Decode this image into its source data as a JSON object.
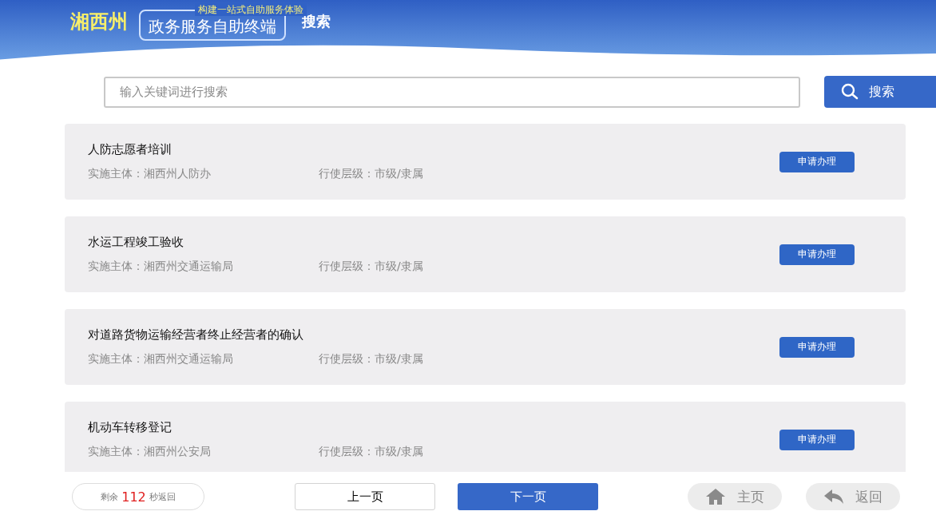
{
  "header": {
    "region": "湘西州",
    "subtitle": "构建一站式自助服务体验",
    "title": "政务服务自助终端",
    "page": "搜索"
  },
  "search": {
    "placeholder": "输入关键词进行搜索",
    "button": "搜索"
  },
  "items": [
    {
      "name": "人防志愿者培训",
      "body_label": "实施主体：",
      "body": "湘西州人防办",
      "level_label": "行使层级：",
      "level_text": "市级/隶属",
      "action": "申请办理"
    },
    {
      "name": "水运工程竣工验收",
      "body_label": "实施主体：",
      "body": "湘西州交通运输局",
      "level_label": "行使层级：",
      "level_text": "市级/隶属",
      "action": "申请办理"
    },
    {
      "name": "对道路货物运输经营者终止经营者的确认",
      "body_label": "实施主体：",
      "body": "湘西州交通运输局",
      "level_label": "行使层级：",
      "level_text": "市级/隶属",
      "action": "申请办理"
    },
    {
      "name": "机动车转移登记",
      "body_label": "实施主体：",
      "body": "湘西州公安局",
      "level_label": "行使层级：",
      "level_text": "市级/隶属",
      "action": "申请办理"
    }
  ],
  "footer": {
    "countdown_prefix": "剩余",
    "countdown": "112",
    "countdown_suffix": "秒返回",
    "prev": "上一页",
    "next": "下一页",
    "home": "主页",
    "back": "返回"
  }
}
